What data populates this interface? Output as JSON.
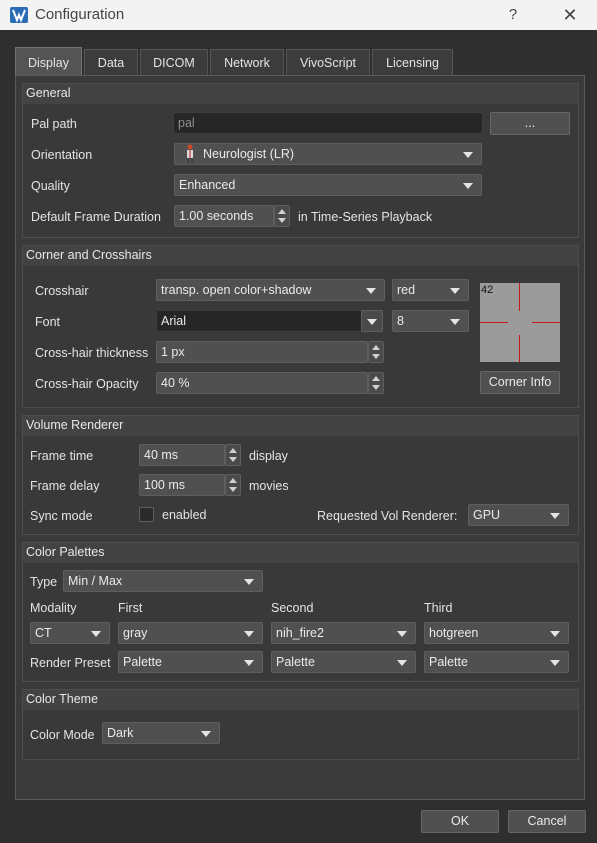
{
  "window": {
    "title": "Configuration",
    "help_glyph": "?",
    "close_glyph": "✕"
  },
  "tabs": [
    "Display",
    "Data",
    "DICOM",
    "Network",
    "VivoScript",
    "Licensing"
  ],
  "general": {
    "title": "General",
    "pal_path_label": "Pal path",
    "pal_path_placeholder": "pal",
    "browse_label": "...",
    "orientation_label": "Orientation",
    "orientation_value": "Neurologist (LR)",
    "quality_label": "Quality",
    "quality_value": "Enhanced",
    "frame_duration_label": "Default Frame Duration",
    "frame_duration_value": "1.00 seconds",
    "frame_duration_suffix": "in Time-Series Playback"
  },
  "corner": {
    "title": "Corner and Crosshairs",
    "crosshair_label": "Crosshair",
    "crosshair_style": "transp. open color+shadow",
    "crosshair_color": "red",
    "font_label": "Font",
    "font_value": "Arial",
    "font_size": "8",
    "thickness_label": "Cross-hair thickness",
    "thickness_value": "1 px",
    "opacity_label": "Cross-hair Opacity",
    "opacity_value": "40 %",
    "preview_number": "42",
    "corner_info_label": "Corner Info",
    "crosshair_hex": "#c51919"
  },
  "volume": {
    "title": "Volume Renderer",
    "frame_time_label": "Frame time",
    "frame_time_value": "40 ms",
    "frame_time_suffix": "display",
    "frame_delay_label": "Frame delay",
    "frame_delay_value": "100 ms",
    "frame_delay_suffix": "movies",
    "sync_label": "Sync mode",
    "sync_checkbox_label": "enabled",
    "sync_checked": false,
    "renderer_label": "Requested Vol Renderer:",
    "renderer_value": "GPU"
  },
  "palettes": {
    "title": "Color Palettes",
    "type_label": "Type",
    "type_value": "Min / Max",
    "headers": [
      "Modality",
      "First",
      "Second",
      "Third"
    ],
    "modality": "CT",
    "first": "gray",
    "second": "nih_fire2",
    "third": "hotgreen",
    "render_preset_label": "Render Preset",
    "preset_first": "Palette",
    "preset_second": "Palette",
    "preset_third": "Palette"
  },
  "theme": {
    "title": "Color Theme",
    "mode_label": "Color Mode",
    "mode_value": "Dark"
  },
  "footer": {
    "ok": "OK",
    "cancel": "Cancel"
  },
  "icons": [
    "app-logo-icon",
    "help-icon",
    "close-icon",
    "person-icon",
    "chevron-down-icon",
    "spin-up-icon",
    "spin-down-icon"
  ],
  "colors": {
    "background": "#2f2f2f",
    "panel": "#3a3a3a",
    "field": "#505050",
    "titlebar": "#f3f3f3"
  }
}
